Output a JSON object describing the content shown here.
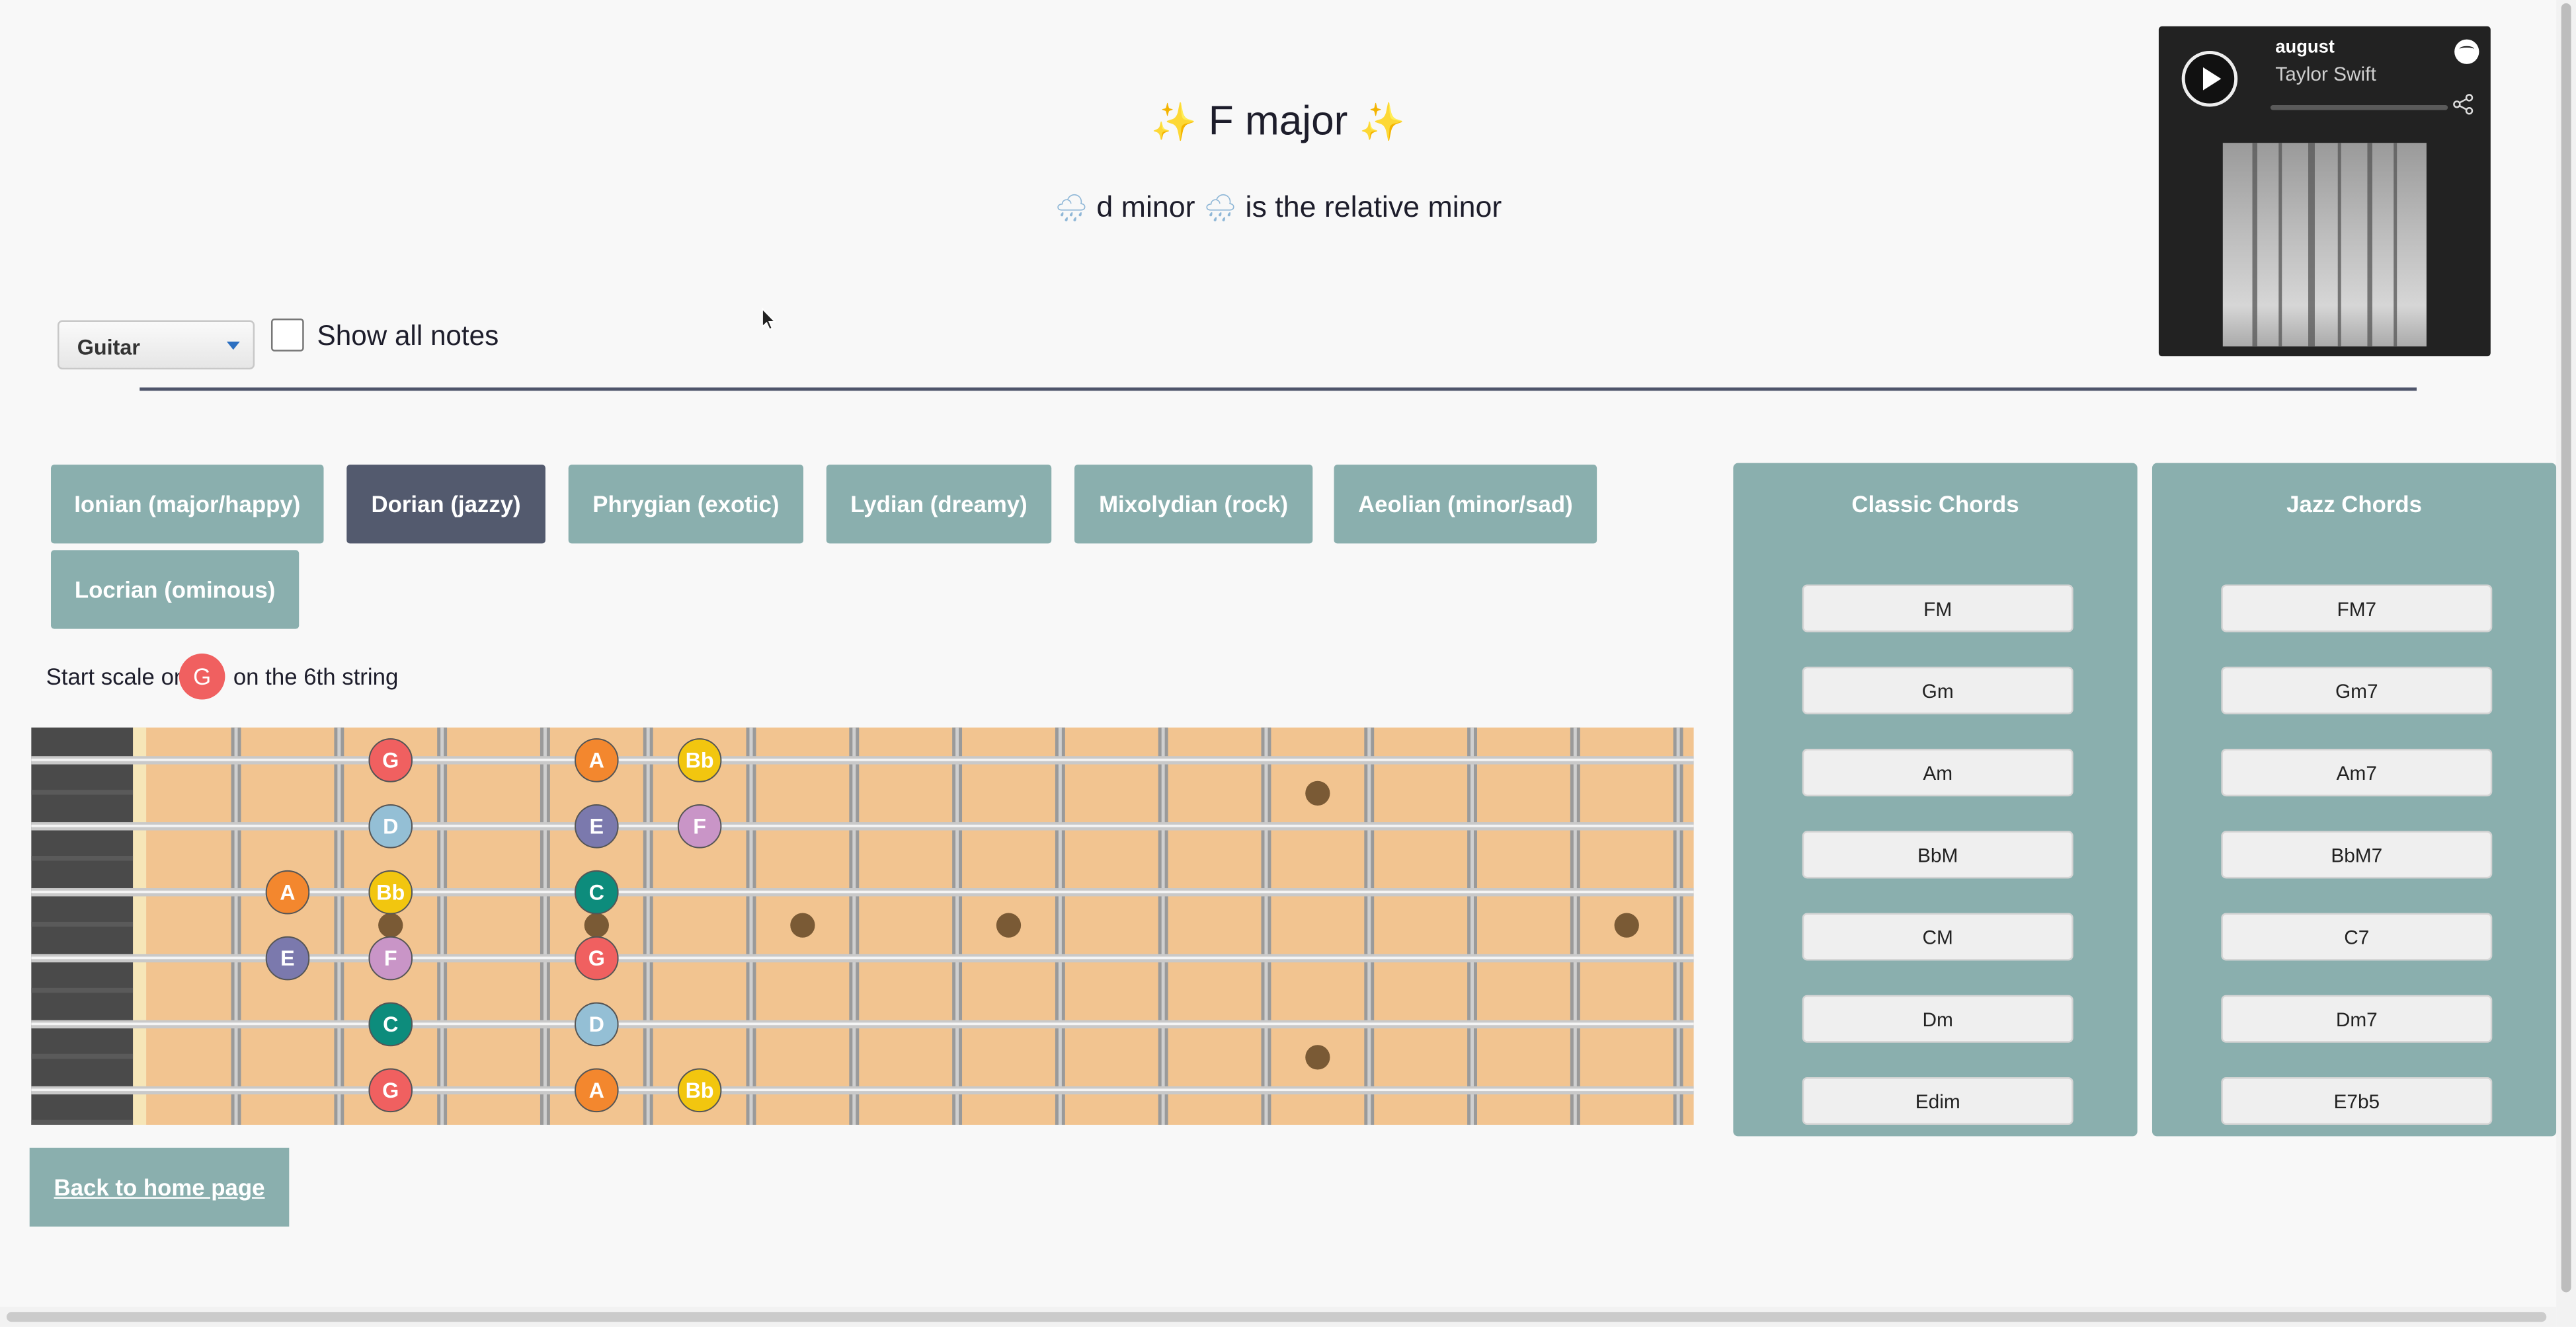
{
  "header": {
    "title": "F major",
    "title_emoji": "✨",
    "subtitle_key": "d minor",
    "subtitle_rest": "is the relative minor",
    "subtitle_emoji": "🌧"
  },
  "spotify": {
    "track": "august",
    "artist": "Taylor Swift",
    "icons": [
      "play-icon",
      "spotify-logo-icon",
      "share-icon"
    ]
  },
  "controls": {
    "instrument": "Guitar",
    "show_all_label": "Show all notes",
    "show_all_checked": false
  },
  "modes": [
    {
      "label": "Ionian (major/happy)",
      "active": false
    },
    {
      "label": "Dorian (jazzy)",
      "active": true
    },
    {
      "label": "Phrygian (exotic)",
      "active": false
    },
    {
      "label": "Lydian (dreamy)",
      "active": false
    },
    {
      "label": "Mixolydian (rock)",
      "active": false
    },
    {
      "label": "Aeolian (minor/sad)",
      "active": false
    },
    {
      "label": "Locrian (ominous)",
      "active": false
    }
  ],
  "start_scale": {
    "prefix": "Start scale on",
    "note": "G",
    "suffix": "on the 6th string"
  },
  "note_colors": {
    "G": "#f06060",
    "A": "#f3872e",
    "Bb": "#f2c60f",
    "C": "#0d8c7c",
    "D": "#94bfd5",
    "E": "#7b79ad",
    "F": "#c995c7"
  },
  "fretboard": {
    "frets": 15,
    "strings": 6,
    "inlay_frets_single": [
      3,
      5,
      7,
      9,
      15
    ],
    "inlay_fret_double": 12,
    "notes": [
      {
        "string": 1,
        "fret": 3,
        "note": "G"
      },
      {
        "string": 1,
        "fret": 5,
        "note": "A"
      },
      {
        "string": 1,
        "fret": 6,
        "note": "Bb"
      },
      {
        "string": 2,
        "fret": 3,
        "note": "D"
      },
      {
        "string": 2,
        "fret": 5,
        "note": "E"
      },
      {
        "string": 2,
        "fret": 6,
        "note": "F"
      },
      {
        "string": 3,
        "fret": 2,
        "note": "A"
      },
      {
        "string": 3,
        "fret": 3,
        "note": "Bb"
      },
      {
        "string": 3,
        "fret": 5,
        "note": "C"
      },
      {
        "string": 4,
        "fret": 2,
        "note": "E"
      },
      {
        "string": 4,
        "fret": 3,
        "note": "F"
      },
      {
        "string": 4,
        "fret": 5,
        "note": "G"
      },
      {
        "string": 5,
        "fret": 3,
        "note": "C"
      },
      {
        "string": 5,
        "fret": 5,
        "note": "D"
      },
      {
        "string": 6,
        "fret": 3,
        "note": "G"
      },
      {
        "string": 6,
        "fret": 5,
        "note": "A"
      },
      {
        "string": 6,
        "fret": 6,
        "note": "Bb"
      }
    ]
  },
  "classic_chords": {
    "title": "Classic Chords",
    "items": [
      "FM",
      "Gm",
      "Am",
      "BbM",
      "CM",
      "Dm",
      "Edim"
    ]
  },
  "jazz_chords": {
    "title": "Jazz Chords",
    "items": [
      "FM7",
      "Gm7",
      "Am7",
      "BbM7",
      "C7",
      "Dm7",
      "E7b5"
    ]
  },
  "back_link": "Back to home page"
}
